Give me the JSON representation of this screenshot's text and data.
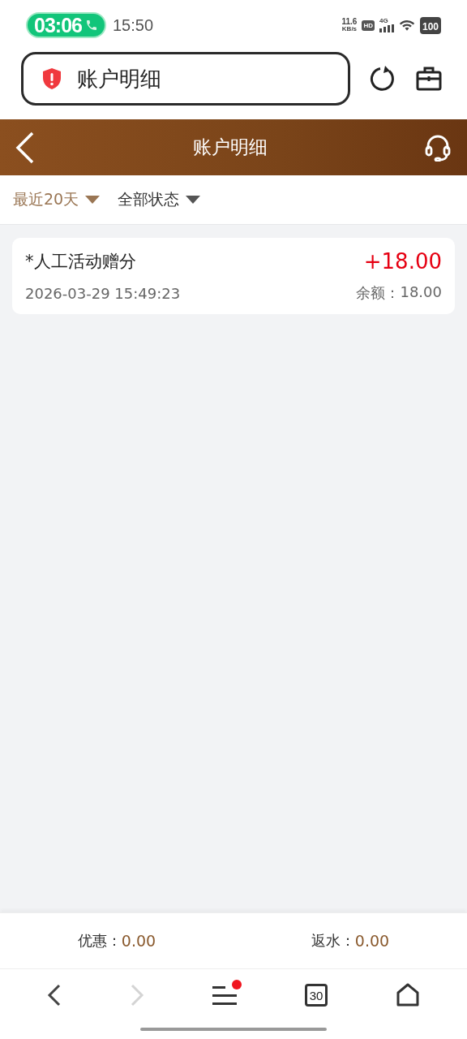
{
  "status_bar": {
    "call_timer": "03:06",
    "time": "15:50",
    "net_speed": "11.6",
    "net_speed_unit": "KB/s",
    "hd_badge": "HD",
    "network": "4G",
    "battery": "100"
  },
  "address_bar": {
    "title": "账户明细"
  },
  "header": {
    "title": "账户明细"
  },
  "filters": [
    {
      "label": "最近20天",
      "selected": true
    },
    {
      "label": "全部状态",
      "selected": false
    }
  ],
  "records": [
    {
      "title": "*人工活动赠分",
      "amount": "+18.00",
      "time": "2026-03-29 15:49:23",
      "balance_label": "余额：",
      "balance": "18.00"
    }
  ],
  "summary": [
    {
      "label": "优惠：",
      "value": "0.00"
    },
    {
      "label": "返水：",
      "value": "0.00"
    }
  ],
  "browser_nav": {
    "forward_disabled": true,
    "menu_badge": true,
    "tabs_count": "30"
  }
}
